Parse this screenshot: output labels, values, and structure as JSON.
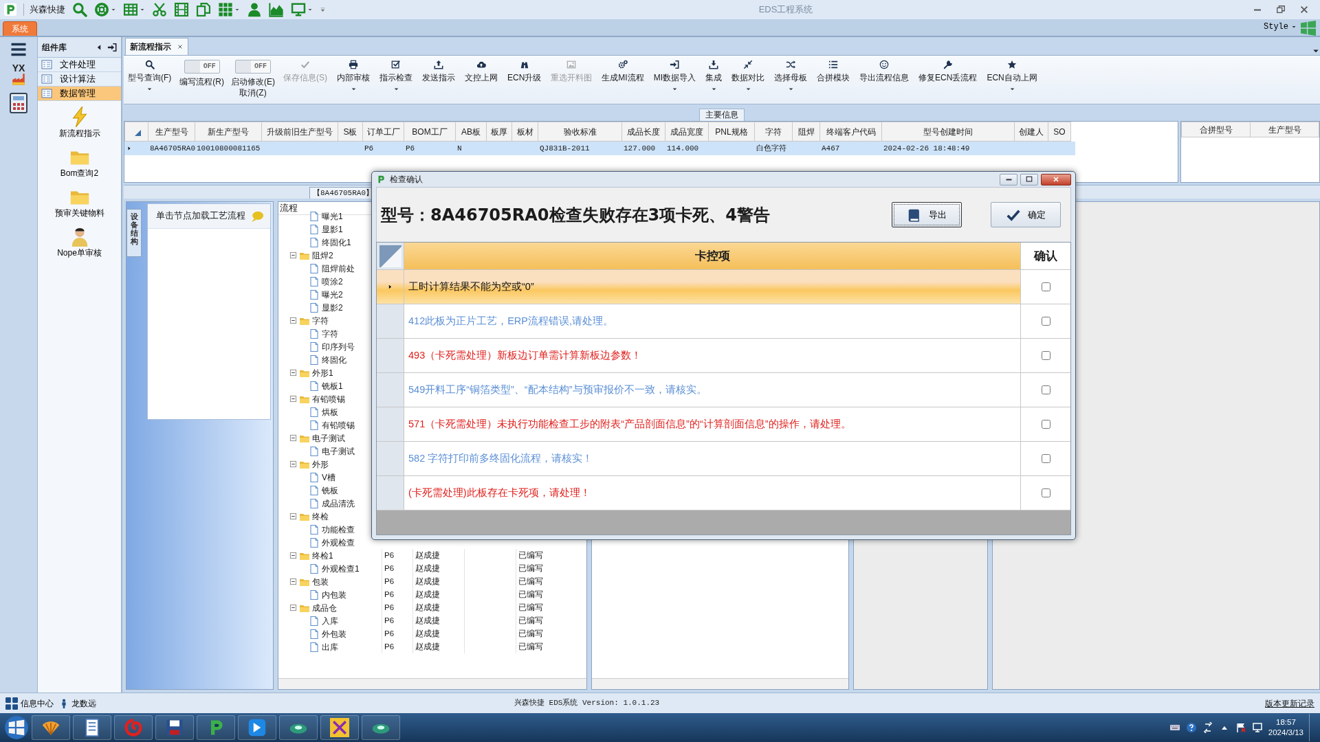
{
  "window": {
    "app_name": "兴森快捷",
    "title": "EDS工程系统"
  },
  "ribbon": {
    "tabs": [
      {
        "label": "系统",
        "selected": true
      }
    ],
    "style_menu": "Style"
  },
  "left_bar": {
    "logo_text": "YX"
  },
  "nav": {
    "title": "组件库",
    "items": [
      {
        "label": "文件处理",
        "selected": false
      },
      {
        "label": "设计算法",
        "selected": false
      },
      {
        "label": "数据管理",
        "selected": true
      }
    ],
    "shortcuts": [
      {
        "label": "新流程指示"
      },
      {
        "label": "Bom查询2"
      },
      {
        "label": "预审关键物料"
      },
      {
        "label": "Nope单审核"
      }
    ]
  },
  "doc_tabs": [
    {
      "label": "新流程指示",
      "selected": true
    }
  ],
  "toolbar": [
    {
      "kind": "button",
      "label": "型号查询(F)",
      "dropdown": true,
      "disabled": false
    },
    {
      "kind": "toggle",
      "label": "编写流程(R)",
      "state_text": "OFF",
      "on": false
    },
    {
      "kind": "toggle",
      "label": "启动修改(E)\n取消(Z)",
      "state_text": "OFF",
      "on": false
    },
    {
      "kind": "button",
      "label": "保存信息(S)",
      "dropdown": false,
      "disabled": true
    },
    {
      "kind": "button",
      "label": "内部审核",
      "dropdown": true,
      "disabled": false
    },
    {
      "kind": "button",
      "label": "指示检查",
      "dropdown": true,
      "disabled": false
    },
    {
      "kind": "button",
      "label": "发送指示",
      "dropdown": false,
      "disabled": false
    },
    {
      "kind": "button",
      "label": "文控上网",
      "dropdown": false,
      "disabled": false
    },
    {
      "kind": "button",
      "label": "ECN升级",
      "dropdown": false,
      "disabled": false
    },
    {
      "kind": "button",
      "label": "重选开料图",
      "dropdown": false,
      "disabled": true
    },
    {
      "kind": "button",
      "label": "生成MI流程",
      "dropdown": false,
      "disabled": false
    },
    {
      "kind": "button",
      "label": "MI数据导入",
      "dropdown": true,
      "disabled": false
    },
    {
      "kind": "button",
      "label": "集成",
      "dropdown": true,
      "disabled": false
    },
    {
      "kind": "button",
      "label": "数据对比",
      "dropdown": true,
      "disabled": false
    },
    {
      "kind": "button",
      "label": "选择母板",
      "dropdown": true,
      "disabled": false
    },
    {
      "kind": "button",
      "label": "合拼模块",
      "dropdown": false,
      "disabled": false
    },
    {
      "kind": "button",
      "label": "导出流程信息",
      "dropdown": false,
      "disabled": false
    },
    {
      "kind": "button",
      "label": "修复ECN丢流程",
      "dropdown": false,
      "disabled": false
    },
    {
      "kind": "button",
      "label": "ECN自动上网",
      "dropdown": true,
      "disabled": false
    }
  ],
  "group_label": "主要信息",
  "grid": {
    "columns": [
      "生产型号",
      "新生产型号",
      "升级前旧生产型号",
      "S板",
      "订单工厂",
      "BOM工厂",
      "AB板",
      "板厚",
      "板材",
      "验收标准",
      "成品长度",
      "成品宽度",
      "PNL规格",
      "字符",
      "阻焊",
      "终端客户代码",
      "型号创建时间",
      "创建人",
      "SO"
    ],
    "rows": [
      {
        "selected": true,
        "cells": [
          "8A46705RA0",
          "10010800081165",
          null,
          null,
          "P6",
          "P6",
          "N",
          null,
          null,
          "QJ831B-2011",
          "127.000",
          "114.000",
          null,
          "白色字符",
          null,
          "A467",
          "2024-02-26 18:48:49",
          null,
          null
        ]
      }
    ]
  },
  "merge_grid": {
    "columns": [
      "合拼型号",
      "生产型号"
    ]
  },
  "lower": {
    "tab": "【8A46705RA0】",
    "side_tab": "设备结构",
    "hint": "单击节点加载工艺流程",
    "tree_header": "流程",
    "tree": [
      {
        "children": [
          {
            "label": "曝光1"
          },
          {
            "label": "显影1"
          },
          {
            "label": "终固化1"
          }
        ]
      },
      {
        "label": "阻焊2",
        "expanded": true,
        "children": [
          {
            "label": "阻焊前处"
          },
          {
            "label": "喷涂2"
          },
          {
            "label": "曝光2"
          },
          {
            "label": "显影2"
          }
        ]
      },
      {
        "label": "字符",
        "expanded": true,
        "children": [
          {
            "label": "字符"
          },
          {
            "label": "印序列号"
          },
          {
            "label": "终固化"
          }
        ]
      },
      {
        "label": "外形1",
        "expanded": true,
        "children": [
          {
            "label": "铣板1"
          }
        ]
      },
      {
        "label": "有铅喷锡",
        "expanded": true,
        "children": [
          {
            "label": "烘板"
          },
          {
            "label": "有铅喷锡"
          }
        ]
      },
      {
        "label": "电子测试",
        "expanded": true,
        "children": [
          {
            "label": "电子测试"
          }
        ]
      },
      {
        "label": "外形",
        "expanded": true,
        "children": [
          {
            "label": "V槽"
          },
          {
            "label": "铣板"
          },
          {
            "label": "成品清洗"
          }
        ]
      },
      {
        "label": "终检",
        "expanded": true,
        "children": [
          {
            "label": "功能检查"
          },
          {
            "label": "外观检查"
          }
        ]
      },
      {
        "label": "终检1",
        "expanded": true,
        "cells": [
          "P6",
          "赵成捷",
          "已编写"
        ],
        "children": [
          {
            "label": "外观检查1",
            "cells": [
              "P6",
              "赵成捷",
              "已编写"
            ]
          }
        ]
      },
      {
        "label": "包装",
        "expanded": true,
        "cells": [
          "P6",
          "赵成捷",
          "已编写"
        ],
        "children": [
          {
            "label": "内包装",
            "cells": [
              "P6",
              "赵成捷",
              "已编写"
            ]
          }
        ]
      },
      {
        "label": "成品仓",
        "expanded": true,
        "cells": [
          "P6",
          "赵成捷",
          "已编写"
        ],
        "children": [
          {
            "label": "入库",
            "cells": [
              "P6",
              "赵成捷",
              "已编写"
            ]
          },
          {
            "label": "外包装",
            "cells": [
              "P6",
              "赵成捷",
              "已编写"
            ]
          },
          {
            "label": "出库",
            "cells": [
              "P6",
              "赵成捷",
              "已编写"
            ]
          }
        ]
      }
    ]
  },
  "dialog": {
    "title": "检查确认",
    "heading": "型号：8A46705RA0检查失败存在3项卡死、4警告",
    "buttons": [
      {
        "label": "导出"
      },
      {
        "label": "确定"
      }
    ],
    "columns": [
      "卡控项",
      "确认"
    ],
    "rows": [
      {
        "text": "工时计算结果不能为空或“0”",
        "kind": "plain",
        "selected": true,
        "checked": false
      },
      {
        "text": "412此板为正片工艺，ERP流程错误,请处理。",
        "kind": "warning",
        "selected": false,
        "checked": false
      },
      {
        "text": "493（卡死需处理）新板边订单需计算新板边参数！",
        "kind": "fatal",
        "selected": false,
        "checked": false
      },
      {
        "text": "549开料工序“铜箔类型”、“配本结构”与预审报价不一致，请核实。",
        "kind": "warning",
        "selected": false,
        "checked": false
      },
      {
        "text": "571（卡死需处理）未执行功能检查工步的附表“产品剖面信息”的“计算剖面信息”的操作，请处理。",
        "kind": "fatal",
        "selected": false,
        "checked": false
      },
      {
        "text": "582 字符打印前多终固化流程，请核实！",
        "kind": "warning",
        "selected": false,
        "checked": false
      },
      {
        "text": "(卡死需处理)此板存在卡死项，请处理！",
        "kind": "fatal",
        "selected": false,
        "checked": false
      }
    ]
  },
  "status_bar": {
    "info": "信息中心",
    "user": "龙数远",
    "version": "兴森快捷 EDS系统 Version: 1.0.1.23",
    "link": "版本更新记录"
  },
  "taskbar": {
    "time": "18:57",
    "date": "2024/3/13"
  }
}
